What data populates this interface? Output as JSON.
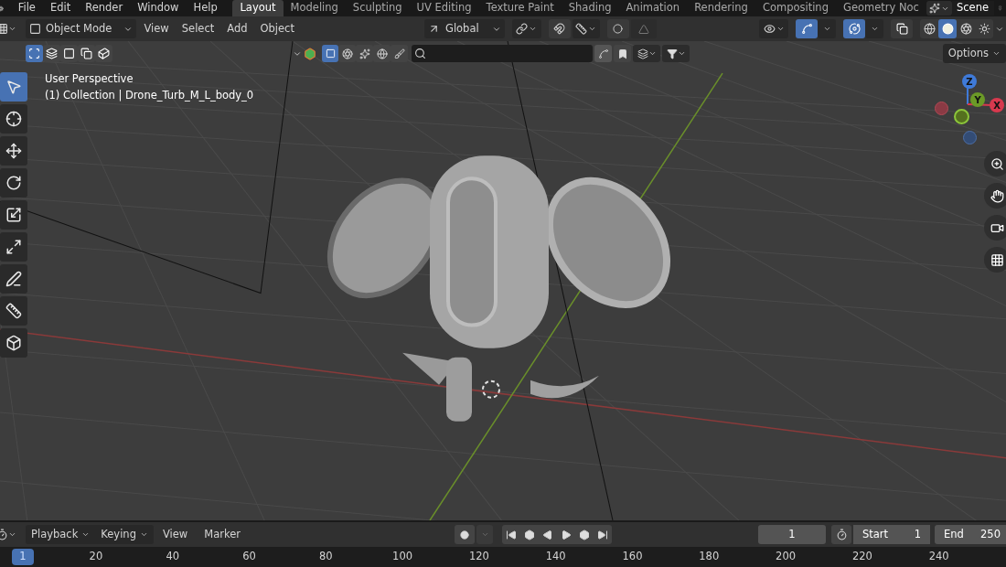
{
  "menu": [
    "File",
    "Edit",
    "Render",
    "Window",
    "Help"
  ],
  "workspaces": [
    {
      "label": "Layout",
      "selected": true
    },
    {
      "label": "Modeling",
      "selected": false
    },
    {
      "label": "Sculpting",
      "selected": false
    },
    {
      "label": "UV Editing",
      "selected": false
    },
    {
      "label": "Texture Paint",
      "selected": false
    },
    {
      "label": "Shading",
      "selected": false
    },
    {
      "label": "Animation",
      "selected": false
    },
    {
      "label": "Rendering",
      "selected": false
    },
    {
      "label": "Compositing",
      "selected": false
    },
    {
      "label": "Geometry Noc",
      "selected": false
    }
  ],
  "scene": "Scene",
  "header": {
    "mode": "Object Mode",
    "menus": [
      "View",
      "Select",
      "Add",
      "Object"
    ],
    "orientation": "Global"
  },
  "viewport_toggles": [
    {
      "kind": "gizmo",
      "on": true
    },
    {
      "kind": "overlay",
      "on": true
    },
    {
      "kind": "xray",
      "on": false
    }
  ],
  "shading_modes": [
    {
      "kind": "wireframe",
      "selected": false
    },
    {
      "kind": "solid",
      "selected": true
    },
    {
      "kind": "material",
      "selected": false
    },
    {
      "kind": "rendered",
      "selected": false
    }
  ],
  "select_modes": [
    {
      "kind": "new",
      "selected": true
    },
    {
      "kind": "extend",
      "selected": false
    },
    {
      "kind": "subtract",
      "selected": false
    },
    {
      "kind": "invert",
      "selected": false
    },
    {
      "kind": "intersect",
      "selected": false
    }
  ],
  "options": "Options",
  "viewport": {
    "view_name": "User Perspective",
    "collection": "(1) Collection | Drone_Turb_M_L_body_0"
  },
  "tools": [
    {
      "kind": "select",
      "selected": true
    },
    {
      "kind": "cursor",
      "selected": false
    },
    {
      "kind": "move",
      "selected": false
    },
    {
      "kind": "rotate",
      "selected": false
    },
    {
      "kind": "scale",
      "selected": false
    },
    {
      "kind": "transform",
      "selected": false
    },
    {
      "kind": "annotate",
      "selected": false
    },
    {
      "kind": "measure",
      "selected": false
    },
    {
      "kind": "add-cube",
      "selected": false
    }
  ],
  "gizmo": {
    "z": "Z",
    "y": "Y",
    "x": "X"
  },
  "timeline": {
    "dropdowns": [
      "Playback",
      "Keying"
    ],
    "menus": [
      "View",
      "Marker"
    ],
    "current_frame": "1",
    "start_label": "Start",
    "start": "1",
    "end_label": "End",
    "end": "250"
  },
  "ruler": {
    "current": "1",
    "ticks": [
      "20",
      "40",
      "60",
      "80",
      "100",
      "120",
      "140",
      "160",
      "180",
      "200",
      "220",
      "240"
    ]
  }
}
